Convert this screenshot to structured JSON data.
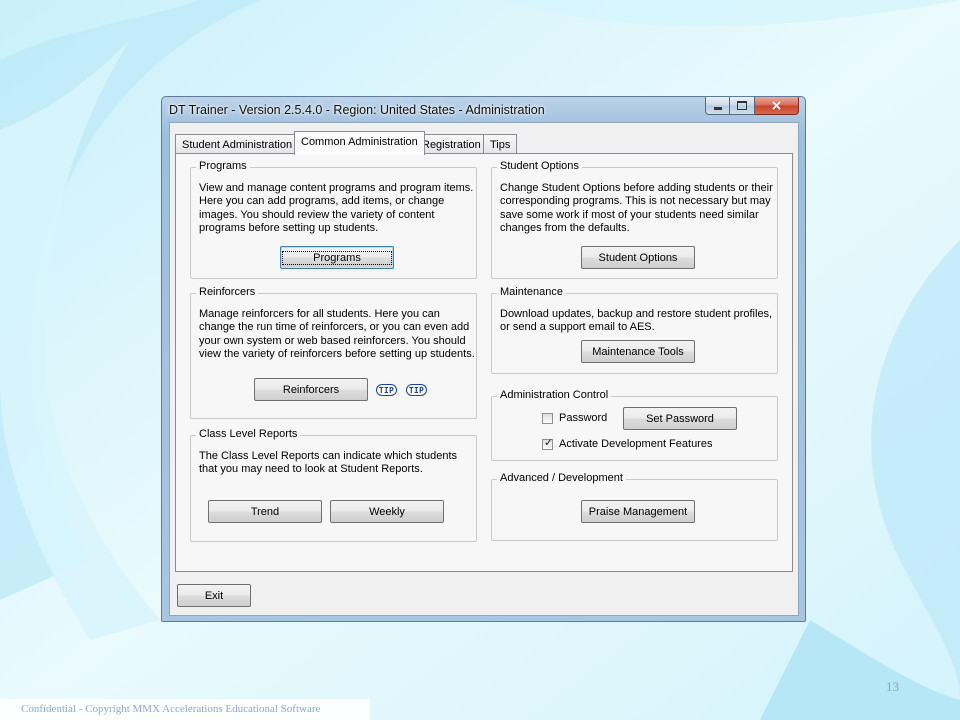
{
  "window": {
    "title": "DT Trainer - Version 2.5.4.0 - Region: United States - Administration",
    "close_glyph": "×"
  },
  "tabs": [
    {
      "label": "Student Administration"
    },
    {
      "label": "Common Administration",
      "active": true
    },
    {
      "label": "Registration"
    },
    {
      "label": "Tips"
    }
  ],
  "programs": {
    "title": "Programs",
    "description": "View and manage content programs and program items.\nHere you can add programs, add items, or change\nimages.  You should review the variety of content\nprograms before setting up students.",
    "button": "Programs"
  },
  "reinforcers": {
    "title": "Reinforcers",
    "description": "Manage reinforcers for all students.  Here you can\nchange the run time of reinforcers, or you can even add\nyour own system or web based reinforcers.  You should\nview the variety of reinforcers before setting up students.",
    "button": "Reinforcers",
    "tip1": "TIP",
    "tip2": "TIP"
  },
  "class_reports": {
    "title": "Class Level Reports",
    "description": "The Class Level Reports can indicate which students\nthat you may need to look at Student Reports.",
    "trend_button": "Trend",
    "weekly_button": "Weekly"
  },
  "student_options": {
    "title": "Student Options",
    "description": "Change Student Options before adding students or their\ncorresponding programs.  This is not necessary but may\nsave some work if most of your students need similar\nchanges from the defaults.",
    "button": "Student Options"
  },
  "maintenance": {
    "title": "Maintenance",
    "description": "Download updates, backup and restore student profiles,\nor send a support email to AES.",
    "button": "Maintenance Tools"
  },
  "admin_control": {
    "title": "Administration Control",
    "password_label": "Password",
    "password_checked": false,
    "set_password_button": "Set Password",
    "dev_label": "Activate Development Features",
    "dev_checked": true,
    "check_glyph": "✓"
  },
  "advanced": {
    "title": "Advanced / Development",
    "button": "Praise Management"
  },
  "exit_button": "Exit",
  "slide": {
    "number": "13",
    "footer": "Confidential - Copyright MMX Accelerations Educational Software"
  },
  "colors": {
    "background": "#e6f8fd",
    "swirl": "#bdeaf8",
    "close_button": "#c7412a",
    "tip_blue": "#1b3fa8"
  }
}
